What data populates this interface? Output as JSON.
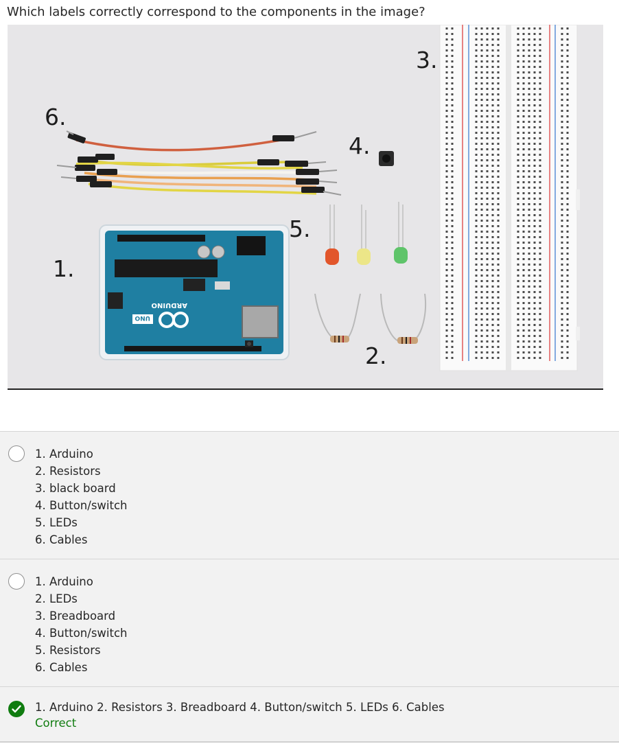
{
  "question": {
    "text": "Which labels correctly correspond to the components in the image?"
  },
  "figure": {
    "callouts": [
      "6.",
      "4.",
      "3.",
      "5.",
      "1.",
      "2."
    ],
    "arduino_brand": "ARDUINO",
    "arduino_model": "UNO"
  },
  "options": [
    {
      "lines": [
        "1. Arduino",
        "2. Resistors",
        "3. black board",
        "4. Button/switch",
        "5. LEDs",
        "6. Cables"
      ],
      "selected": false
    },
    {
      "lines": [
        "1. Arduino",
        "2. LEDs",
        "3. Breadboard",
        "4. Button/switch",
        "5. Resistors",
        "6. Cables"
      ],
      "selected": false
    },
    {
      "text": "1. Arduino 2. Resistors 3. Breadboard 4. Button/switch 5. LEDs 6. Cables",
      "status": "Correct",
      "selected": true
    }
  ],
  "colors": {
    "correct": "#107c10",
    "figure_background": "#e7e6e8",
    "arduino_board": "#1f7fa2"
  },
  "icons": [
    "checkmark-icon",
    "radio-button"
  ]
}
